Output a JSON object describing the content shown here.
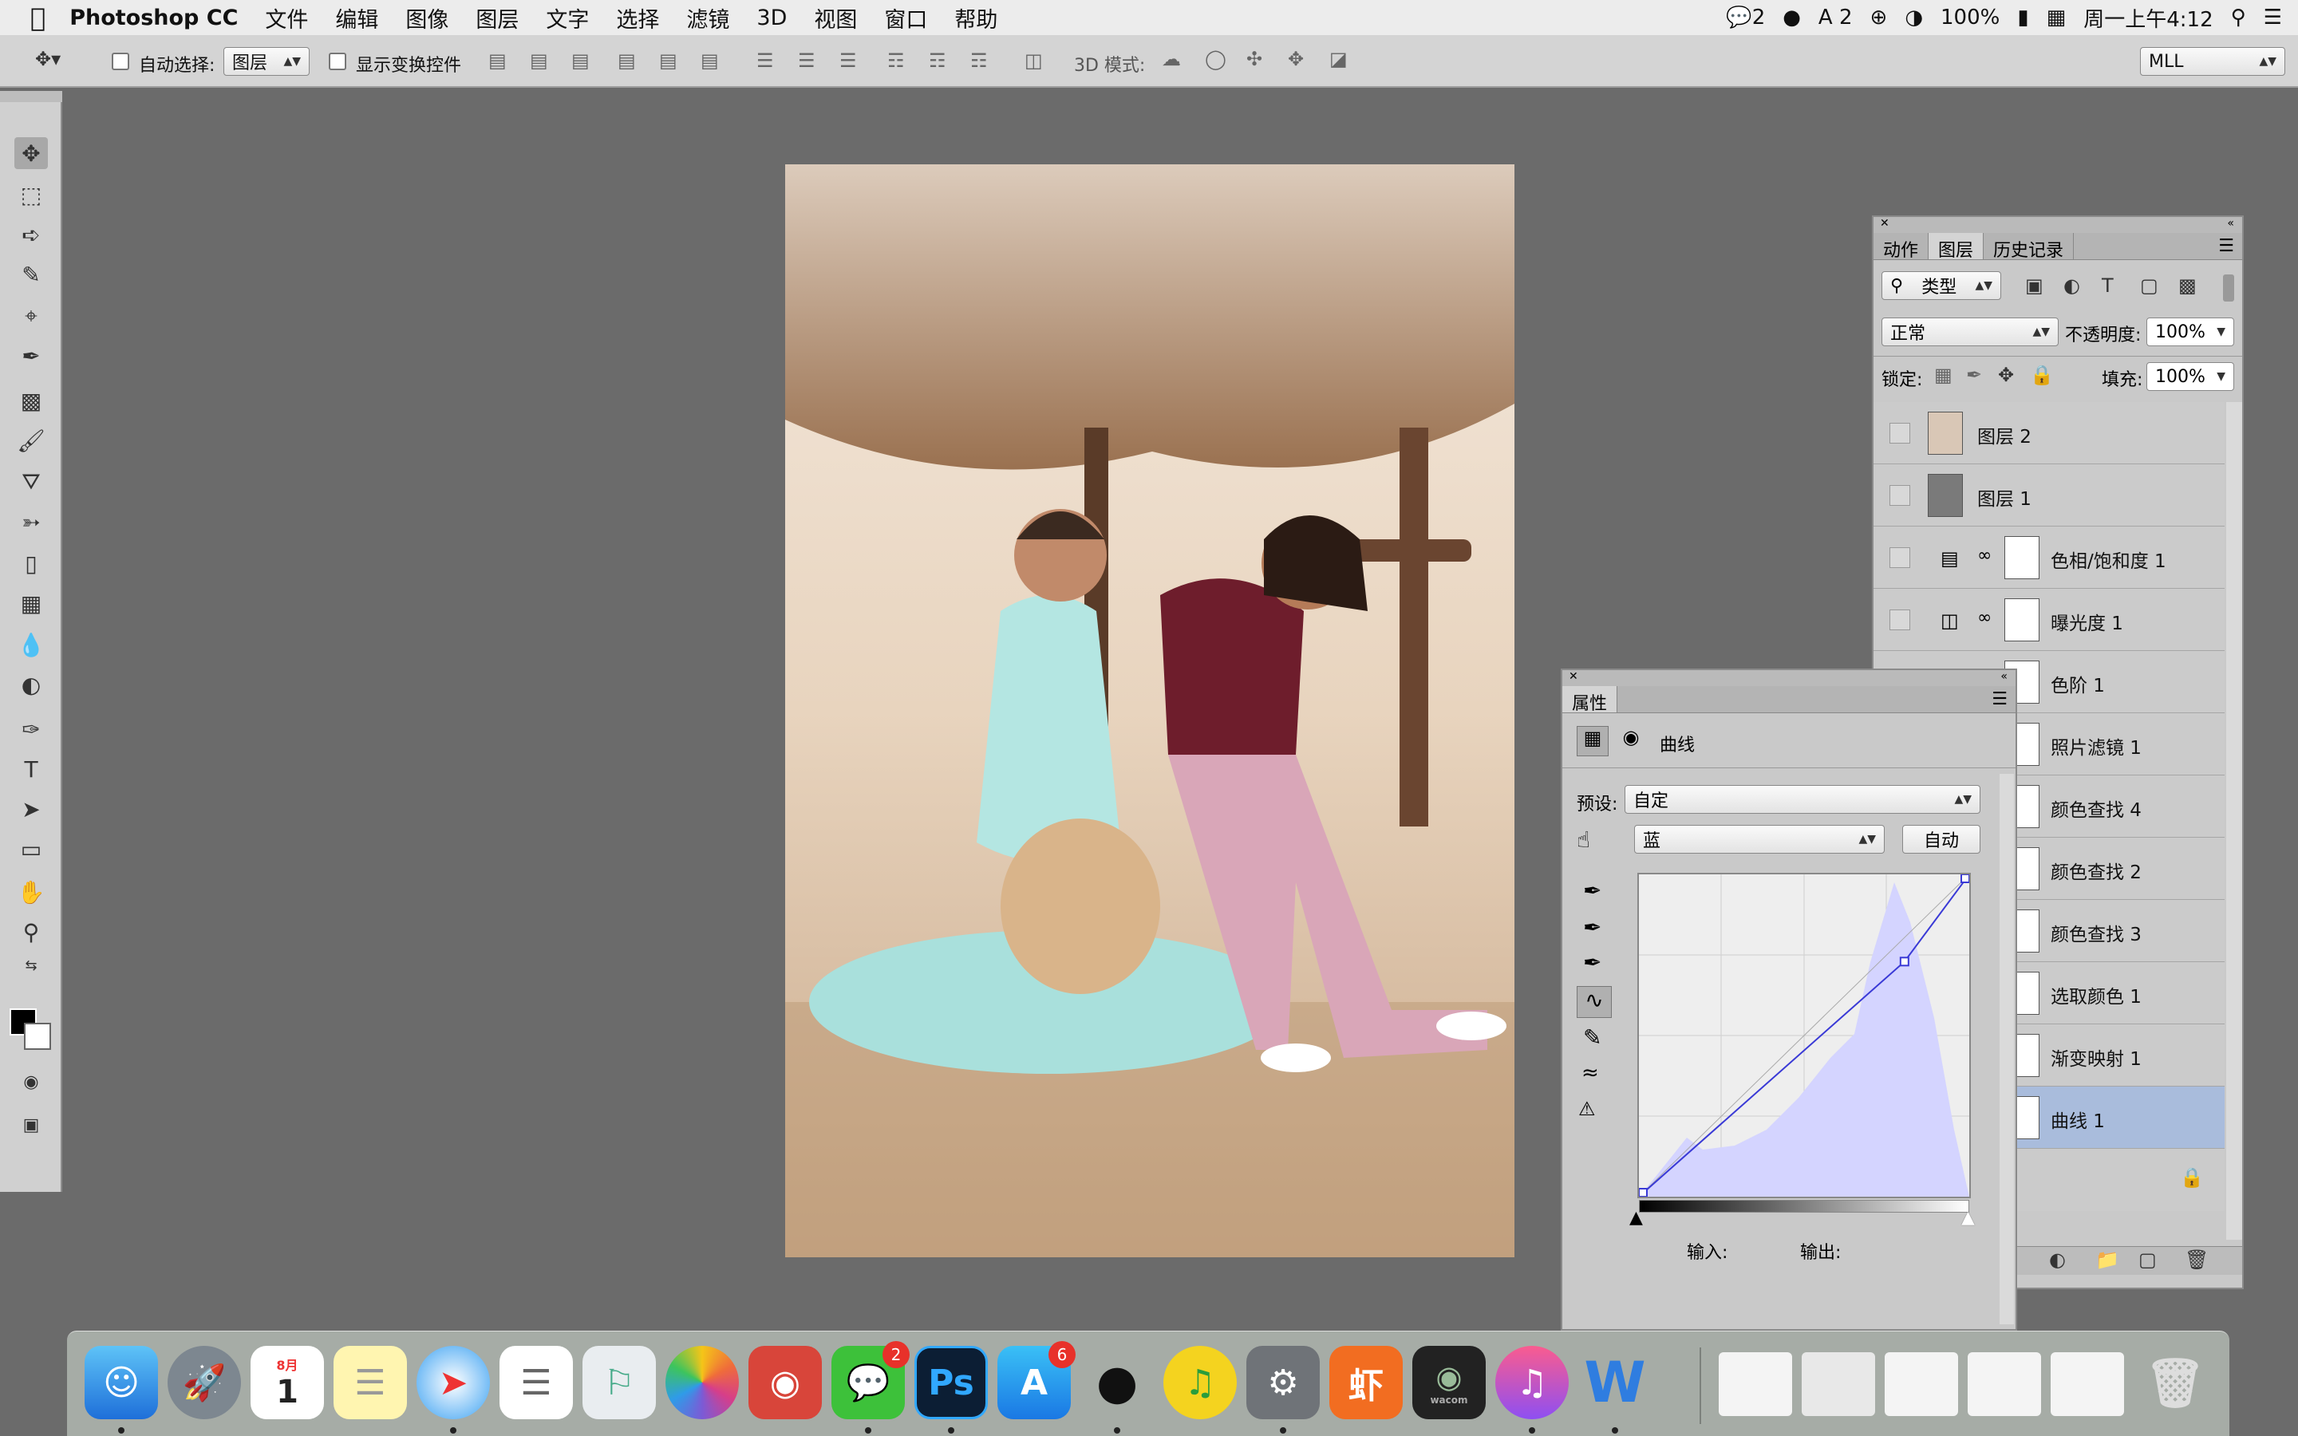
{
  "menubar": {
    "app": "Photoshop CC",
    "items": [
      "文件",
      "编辑",
      "图像",
      "图层",
      "文字",
      "选择",
      "滤镜",
      "3D",
      "视图",
      "窗口",
      "帮助"
    ],
    "status": {
      "qq_count": "2",
      "ai_count": "2",
      "battery": "100%",
      "clock": "周一上午4:12"
    }
  },
  "options": {
    "auto_select_label": "自动选择:",
    "auto_select_value": "图层",
    "show_transform_label": "显示变换控件",
    "mode3d_label": "3D 模式:",
    "workspace": "MLL"
  },
  "layers_panel": {
    "tabs": [
      "动作",
      "图层",
      "历史记录"
    ],
    "active_tab": "图层",
    "filter_kind": "类型",
    "blend_mode": "正常",
    "opacity_label": "不透明度:",
    "opacity": "100%",
    "lock_label": "锁定:",
    "fill_label": "填充:",
    "fill": "100%",
    "layers": [
      {
        "name": "图层 2"
      },
      {
        "name": "图层 1"
      },
      {
        "name": "色相/饱和度 1"
      },
      {
        "name": "曝光度 1"
      },
      {
        "name": "色阶 1"
      },
      {
        "name": "照片滤镜 1"
      },
      {
        "name": "颜色查找 4"
      },
      {
        "name": "颜色查找 2"
      },
      {
        "name": "颜色查找 3"
      },
      {
        "name": "选取颜色 1"
      },
      {
        "name": "渐变映射 1"
      },
      {
        "name": "曲线 1"
      }
    ],
    "selected_layer": "曲线 1"
  },
  "properties_panel": {
    "tab": "属性",
    "title": "曲线",
    "preset_label": "预设:",
    "preset": "自定",
    "channel": "蓝",
    "auto_button": "自动",
    "input_label": "输入:",
    "output_label": "输出:",
    "curve_points": [
      [
        0,
        0
      ],
      [
        205,
        186
      ],
      [
        255,
        255
      ]
    ]
  },
  "dock": {
    "calendar_month": "8月",
    "calendar_day": "1",
    "wechat_badge": "2",
    "appstore_badge": "6",
    "ps_label": "Ps",
    "xiami_label": "虾",
    "word_label": "W",
    "wacom_label": "wacom"
  },
  "colors": {
    "accent_selected": "#a9bcdc",
    "curve_line": "#3a3ad6",
    "histogram": "#d4d4ff"
  }
}
